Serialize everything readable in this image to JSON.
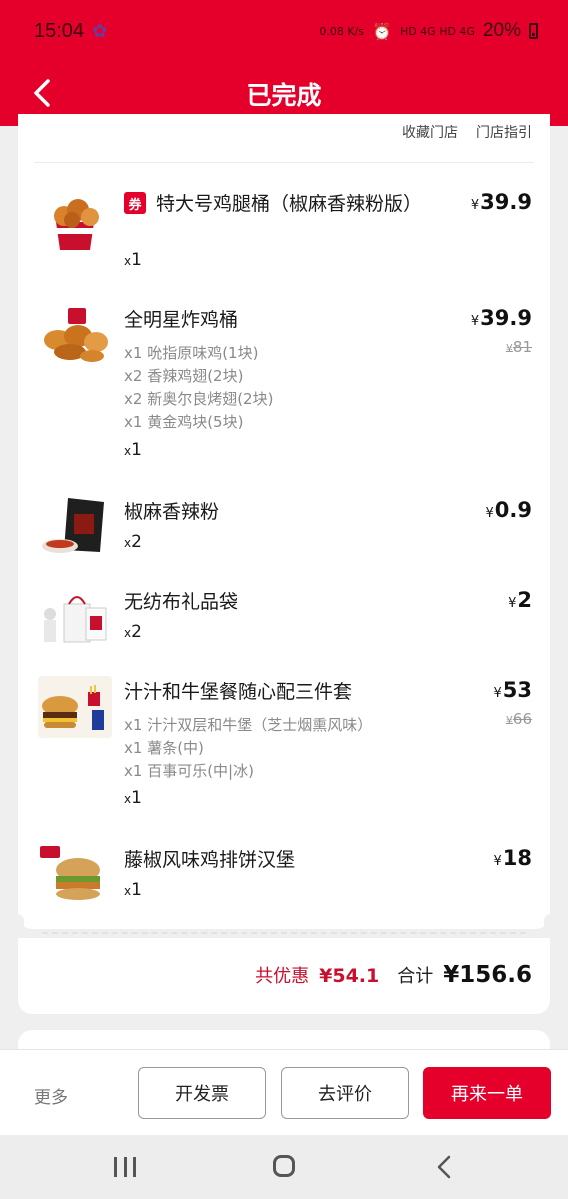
{
  "status_bar": {
    "time": "15:04",
    "speed": "0.08 K/s",
    "network": "HD 4G HD 4G",
    "battery": "20%"
  },
  "header": {
    "title": "已完成"
  },
  "store_links": {
    "favorite": "收藏门店",
    "guide": "门店指引"
  },
  "items": [
    {
      "name": "特大号鸡腿桶（椒麻香辣粉版）",
      "coupon": "券",
      "price": "39.9",
      "qty": "1",
      "thumb_icon": "chicken-bucket-icon"
    },
    {
      "name": "全明星炸鸡桶",
      "price": "39.9",
      "orig_price": "81",
      "subs": [
        "x1 吮指原味鸡(1块)",
        "x2 香辣鸡翅(2块)",
        "x2 新奥尔良烤翅(2块)",
        "x1 黄金鸡块(5块)"
      ],
      "qty": "1",
      "thumb_icon": "fried-chicken-icon"
    },
    {
      "name": "椒麻香辣粉",
      "price": "0.9",
      "qty": "2",
      "thumb_icon": "seasoning-packet-icon"
    },
    {
      "name": "无纺布礼品袋",
      "price": "2",
      "qty": "2",
      "thumb_icon": "gift-bag-icon"
    },
    {
      "name": "汁汁和牛堡餐随心配三件套",
      "price": "53",
      "orig_price": "66",
      "subs": [
        "x1 汁汁双层和牛堡（芝士烟熏风味）",
        "x1 薯条(中)",
        "x1 百事可乐(中|冰)"
      ],
      "qty": "1",
      "thumb_icon": "burger-combo-icon"
    },
    {
      "name": "藤椒风味鸡排饼汉堡",
      "price": "18",
      "qty": "1",
      "thumb_icon": "chicken-burger-icon"
    }
  ],
  "currency": "¥",
  "qty_prefix": "x",
  "totals": {
    "discount_label": "共优惠",
    "discount_value": "¥54.1",
    "sum_label": "合计",
    "sum_value": "¥156.6"
  },
  "actions": {
    "more": "更多",
    "invoice": "开发票",
    "review": "去评价",
    "reorder": "再来一单"
  },
  "colors": {
    "brand_red": "#e4002b",
    "discount_red": "#c8102e"
  }
}
